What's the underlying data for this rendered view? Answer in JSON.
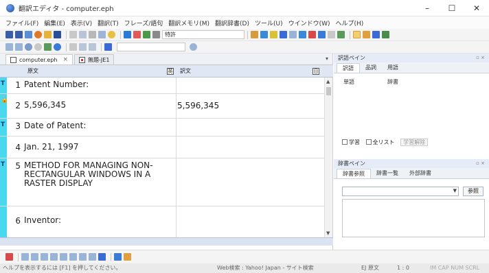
{
  "window": {
    "title": "翻訳エディタ - computer.eph",
    "minimize": "–",
    "maximize": "☐",
    "close": "✕"
  },
  "menu": [
    "ファイル(F)",
    "編集(E)",
    "表示(V)",
    "翻訳(T)",
    "フレーズ/語句",
    "翻訳メモリ(M)",
    "翻訳辞書(D)",
    "ツール(U)",
    "ウインドウ(W)",
    "ヘルプ(H)"
  ],
  "toolbar": {
    "field_combo": "特許",
    "font_combo": ""
  },
  "editor": {
    "tabs": [
      {
        "label": "computer.eph",
        "close": "×"
      },
      {
        "label": "無題-JE1"
      }
    ],
    "pane_arrow": "▾",
    "columns": {
      "source": "原文",
      "target": "訳文",
      "source_badge": "英",
      "target_badge": "日"
    },
    "rows": [
      {
        "marker": "T",
        "num": "1",
        "source": "Patent Number:",
        "target": ""
      },
      {
        "marker": "lock",
        "num": "2",
        "source": "5,596,345",
        "target": "5,596,345"
      },
      {
        "marker": "T",
        "num": "3",
        "source": "Date of Patent:",
        "target": ""
      },
      {
        "marker": "",
        "num": "4",
        "source": "Jan. 21, 1997",
        "target": ""
      },
      {
        "marker": "T",
        "num": "5",
        "source": "METHOD FOR MANAGING NON-RECTANGULAR WINDOWS IN A RASTER DISPLAY",
        "target": ""
      },
      {
        "marker": "",
        "num": "6",
        "source": "Inventor:",
        "target": ""
      }
    ]
  },
  "translation_pane": {
    "title": "訳語ペイン",
    "pin": "▫ ×",
    "tabs": [
      "訳語",
      "品詞",
      "用語"
    ],
    "col_word": "単語",
    "col_dict": "辞書",
    "learn_label": "学習",
    "all_list_label": "全リスト",
    "unlearn_button": "学習解除"
  },
  "dictionary_pane": {
    "title": "辞書ペイン",
    "pin": "▫ ×",
    "tabs": [
      "辞書参照",
      "辞書一覧",
      "外部辞書"
    ],
    "combo_value": "",
    "ref_button": "参照"
  },
  "status": {
    "hint": "ヘルプを表示するには [F1] を押してください。",
    "web_search": "Web検索 : Yahoo! Japan - サイト検索",
    "lang": "EJ 原文",
    "pos": "1 : 0",
    "caps": "IM CAP NUM SCRL"
  },
  "colors": {
    "row_marker": "#49d8ee",
    "header_bg": "#dfe6f4"
  }
}
